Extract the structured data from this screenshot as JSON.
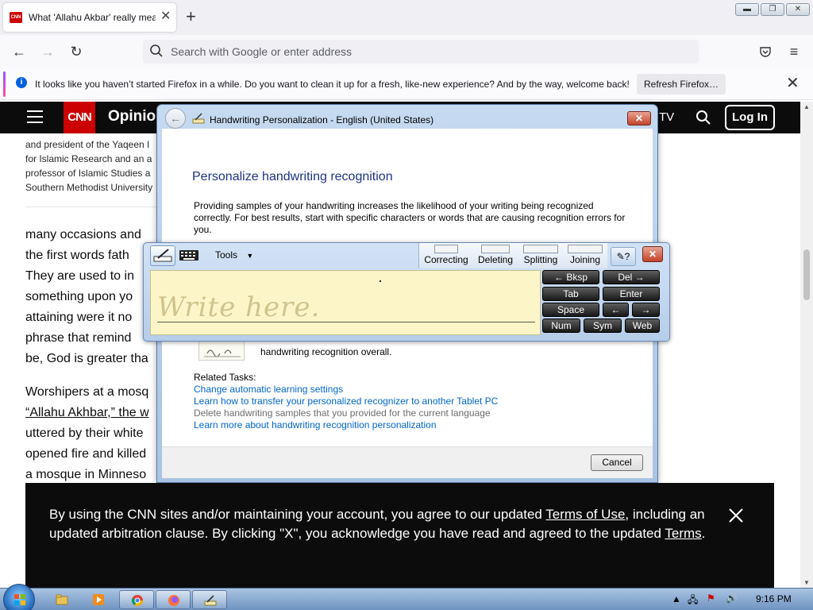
{
  "browser": {
    "tab": {
      "favicon_text": "CNN",
      "title": "What 'Allahu Akbar' really mean",
      "close": "✕"
    },
    "new_tab": "+",
    "url_placeholder": "Search with Google or enter address",
    "notification": {
      "text": "It looks like you haven’t started Firefox in a while. Do you want to clean it up for a fresh, like-new experience? And by the way, welcome back!",
      "button": "Refresh Firefox…",
      "close": "✕"
    }
  },
  "cnn": {
    "logo": "CNN",
    "section": "Opinion",
    "tv": "TV",
    "login": "Log In",
    "bio_lines": [
      "and president of the Yaqeen I",
      "for Islamic Research and an a",
      "professor of Islamic Studies a",
      "Southern Methodist University"
    ],
    "article_lines": [
      "many occasions and",
      "the first words fath",
      "They are used to in",
      "something upon yo",
      "attaining were it no",
      "phrase that remind",
      "be, God is greater tha"
    ],
    "article_lines_2": [
      "Worshipers at a mosq",
      "“Allahu Akhbar,” the w",
      "uttered by their white",
      "opened fire and killed",
      "a mosque in Minneso"
    ],
    "cookie": {
      "part1": "By using the CNN sites and/or maintaining your account, you agree to our updated ",
      "link1": "Terms of Use",
      "part2": ", including an updated arbitration clause. By clicking \"X\", you acknowledge you have read and agreed to the updated ",
      "link2": "Terms",
      "part3": "."
    }
  },
  "dialog": {
    "title": "Handwriting Personalization - English (United States)",
    "close": "✕",
    "heading": "Personalize handwriting recognition",
    "paragraph": "Providing samples of your handwriting increases the likelihood of your writing being recognized correctly. For best results, start with specific characters or words that are causing recognition errors for you.",
    "overall_text": "handwriting recognition overall.",
    "related_tasks": "Related Tasks:",
    "links": [
      "Change automatic learning settings",
      "Learn how to transfer your personalized recognizer to another Tablet PC",
      "Delete handwriting samples that you provided for the current language",
      "Learn more about handwriting recognition personalization"
    ],
    "cancel": "Cancel"
  },
  "input_panel": {
    "tools": "Tools",
    "gestures": [
      "Correcting",
      "Deleting",
      "Splitting",
      "Joining"
    ],
    "close": "✕",
    "write_hint": "Write here.",
    "keys": {
      "bksp": "← Bksp",
      "del": "Del →",
      "tab": "Tab",
      "enter": "Enter",
      "space": "Space",
      "left": "←",
      "right": "→",
      "num": "Num",
      "sym": "Sym",
      "web": "Web"
    }
  },
  "taskbar": {
    "clock": "9:16 PM"
  },
  "colors": {
    "cnn_red": "#cc0000",
    "link_blue": "#0066cc",
    "dialog_heading": "#1e3287"
  }
}
